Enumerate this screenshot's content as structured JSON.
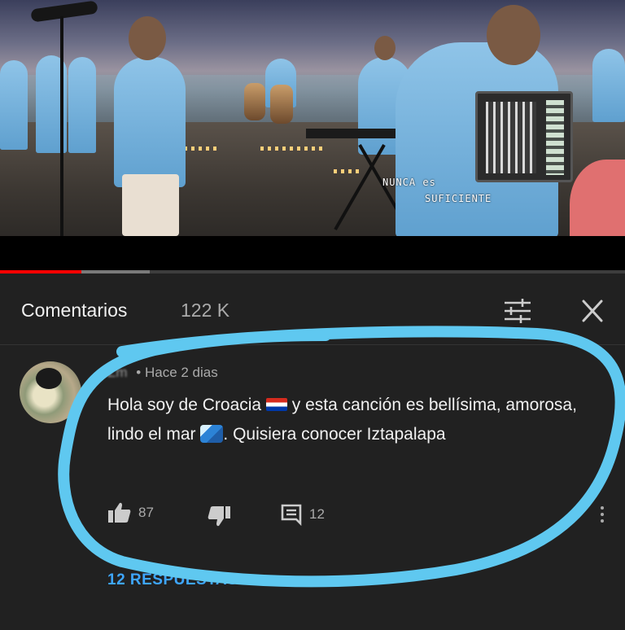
{
  "video": {
    "watermark_line1": "NUNCA es",
    "watermark_line2": "SUFICIENTE",
    "progress": 0.13,
    "buffered": 0.24
  },
  "comments_panel": {
    "title": "Comentarios",
    "count": "122 K",
    "filter_icon": "sort-sliders-icon",
    "close_icon": "close-icon"
  },
  "comment": {
    "author": "Zm",
    "time": "• Hace 2 dias",
    "text_part1": "Hola soy de Croacia",
    "flag_emoji": "croatia-flag-emoji",
    "text_part2": "y esta canción es bellísima, amorosa, lindo el mar",
    "wave_emoji": "water-wave-emoji",
    "text_part3": ". Quisiera conocer Iztapalapa",
    "likes": "87",
    "replies_count": "12",
    "replies_link": "12 RESPUESTAS"
  },
  "colors": {
    "background": "#212121",
    "text_primary": "#f1f1f1",
    "text_secondary": "#aaaaaa",
    "link_blue": "#3ea6ff",
    "progress_red": "#ff0000",
    "highlight_scribble": "#5fc8f0"
  }
}
